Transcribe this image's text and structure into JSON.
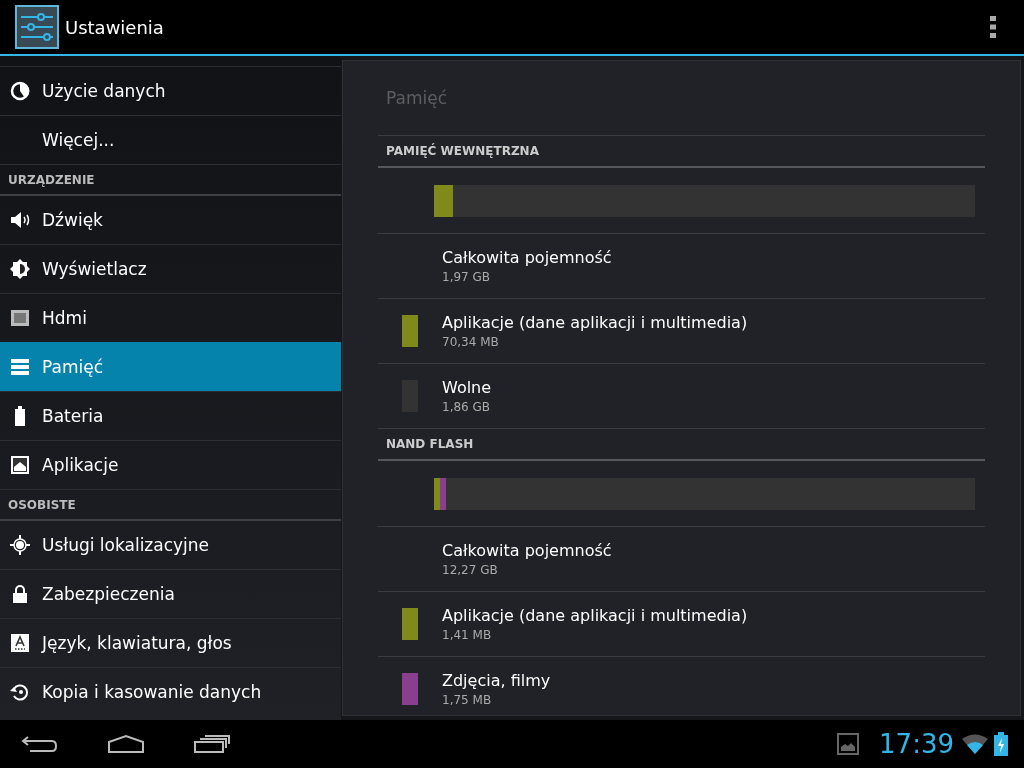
{
  "action_bar": {
    "title": "Ustawienia"
  },
  "sidebar": {
    "entries": [
      {
        "kind": "item",
        "label": "Użycie danych",
        "selected": false
      },
      {
        "kind": "item",
        "label": "Więcej...",
        "selected": false
      },
      {
        "kind": "header",
        "label": "URZĄDZENIE"
      },
      {
        "kind": "item",
        "label": "Dźwięk",
        "selected": false
      },
      {
        "kind": "item",
        "label": "Wyświetlacz",
        "selected": false
      },
      {
        "kind": "item",
        "label": "Hdmi",
        "selected": false
      },
      {
        "kind": "item",
        "label": "Pamięć",
        "selected": true
      },
      {
        "kind": "item",
        "label": "Bateria",
        "selected": false
      },
      {
        "kind": "item",
        "label": "Aplikacje",
        "selected": false
      },
      {
        "kind": "header",
        "label": "OSOBISTE"
      },
      {
        "kind": "item",
        "label": "Usługi lokalizacyjne",
        "selected": false
      },
      {
        "kind": "item",
        "label": "Zabezpieczenia",
        "selected": false
      },
      {
        "kind": "item",
        "label": "Język, klawiatura, głos",
        "selected": false
      },
      {
        "kind": "item",
        "label": "Kopia i kasowanie danych",
        "selected": false
      }
    ]
  },
  "detail": {
    "title": "Pamięć",
    "sections": [
      {
        "title": "PAMIĘĆ WEWNĘTRZNA",
        "bar": [
          {
            "color": "#7f8a1b",
            "level": 0.035
          }
        ],
        "rows": [
          {
            "label": "Całkowita pojemność",
            "value": "1,97 GB"
          },
          {
            "label": "Aplikacje (dane aplikacji i multimedia)",
            "value": "70,34 MB",
            "color": "#7f8a1b"
          },
          {
            "label": "Wolne",
            "value": "1,86 GB",
            "color": "#333333"
          }
        ]
      },
      {
        "title": "NAND FLASH",
        "bar": [
          {
            "color": "#7f8a1b",
            "level": 0.011
          },
          {
            "color": "#8a3f8e",
            "level": 0.011
          }
        ],
        "rows": [
          {
            "label": "Całkowita pojemność",
            "value": "12,27 GB"
          },
          {
            "label": "Aplikacje (dane aplikacji i multimedia)",
            "value": "1,41 MB",
            "color": "#7f8a1b"
          },
          {
            "label": "Zdjęcia, filmy",
            "value": "1,75 MB",
            "color": "#8a3f8e"
          }
        ]
      }
    ]
  },
  "status_bar": {
    "time": "17:39"
  }
}
